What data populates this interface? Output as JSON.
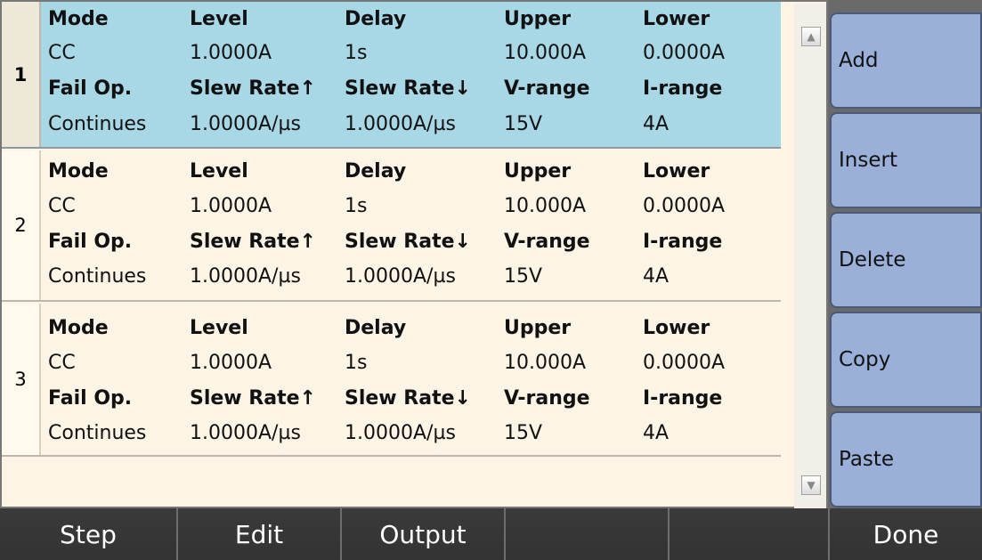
{
  "labels": {
    "mode": "Mode",
    "level": "Level",
    "delay": "Delay",
    "upper": "Upper",
    "lower": "Lower",
    "fail_op": "Fail Op.",
    "slew_up": "Slew Rate↑",
    "slew_down": "Slew Rate↓",
    "v_range": "V-range",
    "i_range": "I-range"
  },
  "steps": [
    {
      "index": "1",
      "selected": true,
      "mode": "CC",
      "level": "1.0000A",
      "delay": "1s",
      "upper": "10.000A",
      "lower": "0.0000A",
      "fail_op": "Continues",
      "slew_up": "1.0000A/µs",
      "slew_down": "1.0000A/µs",
      "v_range": "15V",
      "i_range": "4A"
    },
    {
      "index": "2",
      "selected": false,
      "mode": "CC",
      "level": "1.0000A",
      "delay": "1s",
      "upper": "10.000A",
      "lower": "0.0000A",
      "fail_op": "Continues",
      "slew_up": "1.0000A/µs",
      "slew_down": "1.0000A/µs",
      "v_range": "15V",
      "i_range": "4A"
    },
    {
      "index": "3",
      "selected": false,
      "mode": "CC",
      "level": "1.0000A",
      "delay": "1s",
      "upper": "10.000A",
      "lower": "0.0000A",
      "fail_op": "Continues",
      "slew_up": "1.0000A/µs",
      "slew_down": "1.0000A/µs",
      "v_range": "15V",
      "i_range": "4A"
    }
  ],
  "side_buttons": [
    "Add",
    "Insert",
    "Delete",
    "Copy",
    "Paste"
  ],
  "bottom_buttons": [
    "Step",
    "Edit",
    "Output",
    "",
    "",
    "Done"
  ],
  "icons": {
    "scroll_up": "triangle-up",
    "scroll_down": "triangle-down"
  },
  "colors": {
    "selected_row": "#a8d8e6",
    "panel_bg": "#fcf4e4",
    "side_button": "#9ab0d8",
    "bottom_bar": "#3a3a3a"
  }
}
